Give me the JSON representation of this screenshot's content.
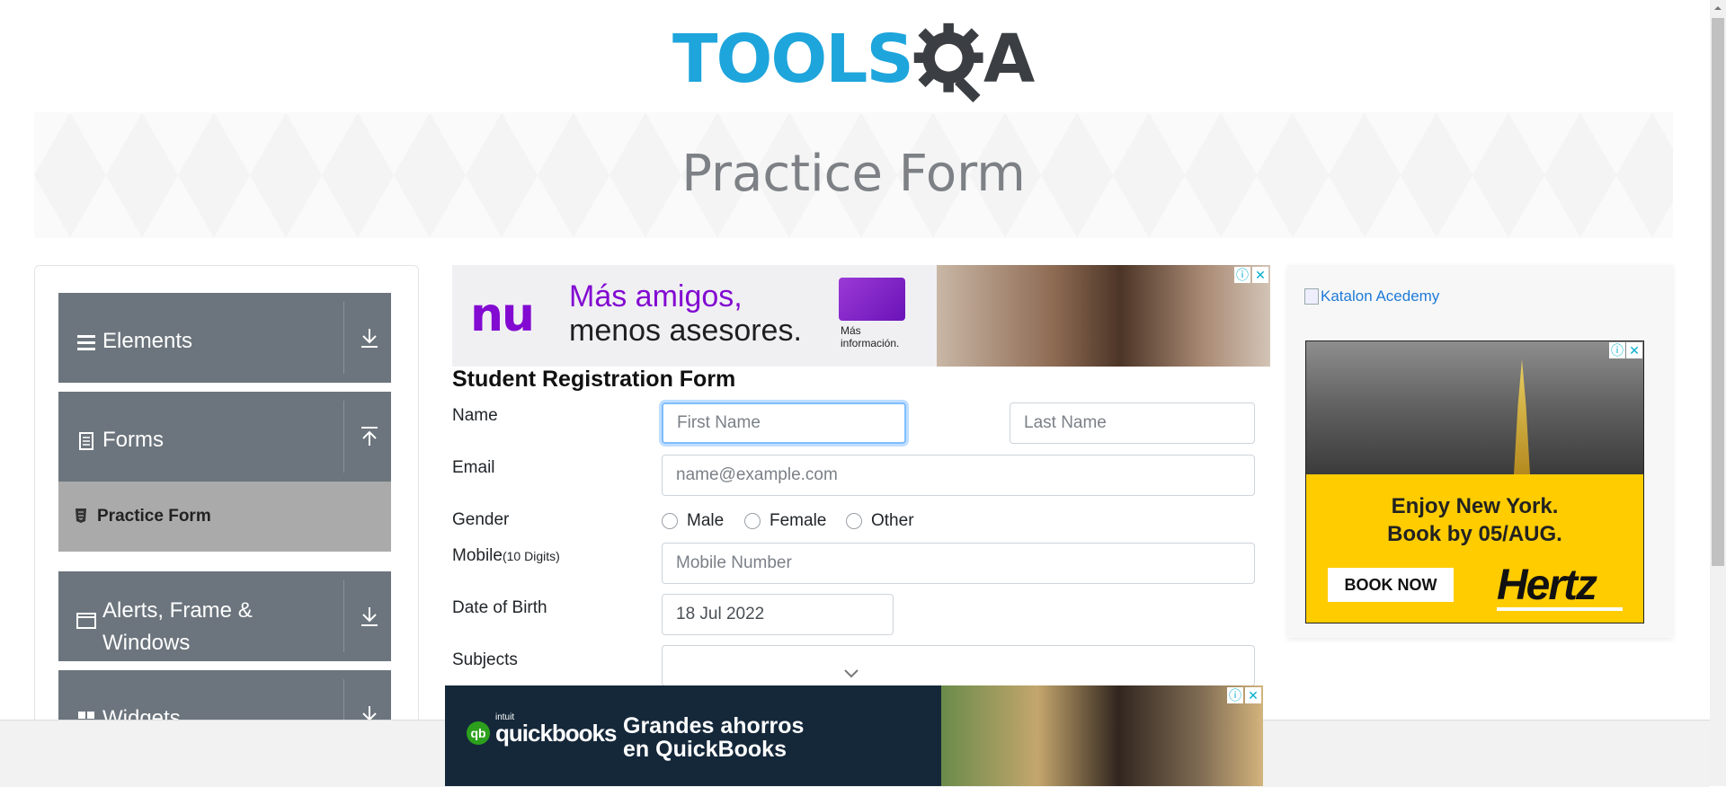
{
  "logo": {
    "text_main": "TOOLS",
    "text_accent": "A",
    "alt": "TOOLSQA"
  },
  "banner": {
    "title": "Practice Form"
  },
  "sidebar": {
    "groups": [
      {
        "label": "Elements",
        "icon": "hamburger-icon",
        "arrow": "download-arrow-icon"
      },
      {
        "label": "Forms",
        "icon": "document-icon",
        "arrow": "upload-arrow-icon"
      },
      {
        "label": "Alerts, Frame & Windows",
        "icon": "window-icon",
        "arrow": "download-arrow-icon"
      },
      {
        "label": "Widgets",
        "icon": "widgets-icon",
        "arrow": "download-arrow-icon"
      }
    ],
    "active_item": {
      "label": "Practice Form",
      "icon": "html5-icon"
    }
  },
  "ad_top": {
    "brand": "nu",
    "line1": "Más amigos,",
    "line2": "menos asesores.",
    "more": "Más información."
  },
  "form": {
    "title": "Student Registration Form",
    "labels": {
      "name": "Name",
      "email": "Email",
      "gender": "Gender",
      "mobile": "Mobile",
      "mobile_hint": "(10 Digits)",
      "dob": "Date of Birth",
      "subjects": "Subjects"
    },
    "placeholders": {
      "first_name": "First Name",
      "last_name": "Last Name",
      "email": "name@example.com",
      "mobile": "Mobile Number"
    },
    "dob_value": "18 Jul 2022",
    "gender_options": [
      "Male",
      "Female",
      "Other"
    ]
  },
  "right_ad": {
    "katalon": "Katalon Acedemy",
    "enjoy_line1": "Enjoy New York.",
    "enjoy_line2": "Book by 05/AUG.",
    "book_now": "BOOK NOW",
    "brand": "Hertz"
  },
  "ad_bottom": {
    "intuit": "intuit",
    "brand": "quickbooks",
    "headline_line1": "Grandes ahorros",
    "headline_line2": "en QuickBooks"
  },
  "colors": {
    "sidebar_group": "#6c757d",
    "active_item": "#aaaaaa",
    "logo_blue": "#1ea5dc",
    "focus_border": "#80bdff",
    "ad_accent": "#820ad1",
    "hertz_yellow": "#ffcc00"
  }
}
